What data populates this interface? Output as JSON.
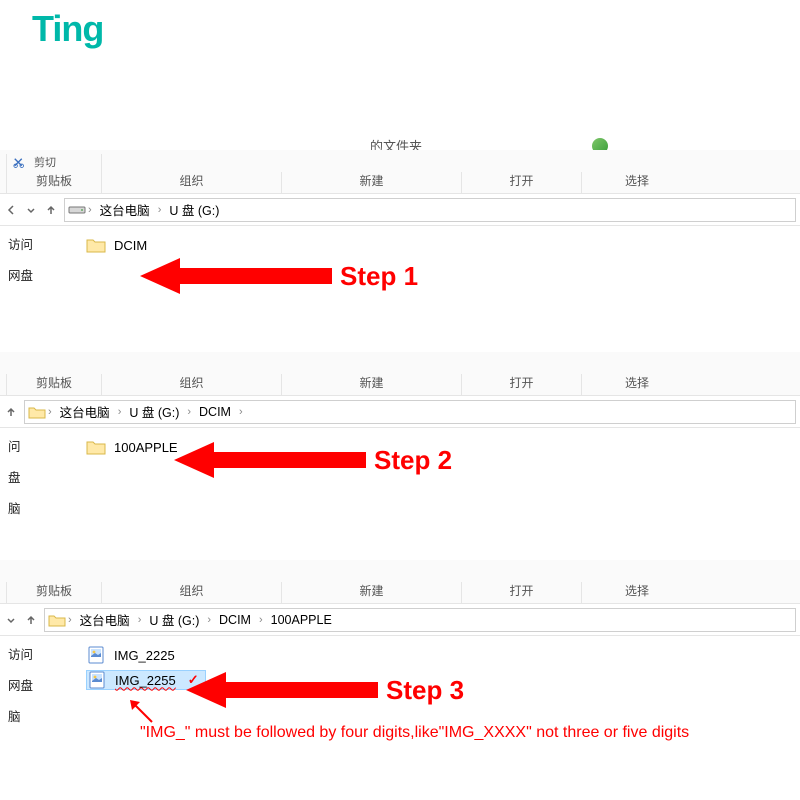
{
  "watermark": "Ting",
  "toolbar": {
    "clipboard": "剪贴板",
    "organize": "组织",
    "newitem": "新建",
    "open": "打开",
    "select": "选择",
    "cut_partial": "剪切",
    "rename_partial": "的文件夹"
  },
  "nav": {
    "back": "‹",
    "fwd": "›",
    "up": "↑"
  },
  "crumbs": {
    "thispc": "这台电脑",
    "udisk": "U 盘 (G:)",
    "dcim": "DCIM",
    "apple": "100APPLE"
  },
  "side": {
    "access": "访问",
    "netdisk": "网盘",
    "wen": "问",
    "pan": "盘",
    "nao": "脑"
  },
  "folders": {
    "dcim": "DCIM",
    "apple": "100APPLE"
  },
  "files": {
    "f1": "IMG_2225",
    "f2": "IMG_2255"
  },
  "steps": {
    "s1": "Step 1",
    "s2": "Step 2",
    "s3": "Step 3"
  },
  "note": "\"IMG_\" must be followed by four digits,like\"IMG_XXXX\" not three or five digits"
}
